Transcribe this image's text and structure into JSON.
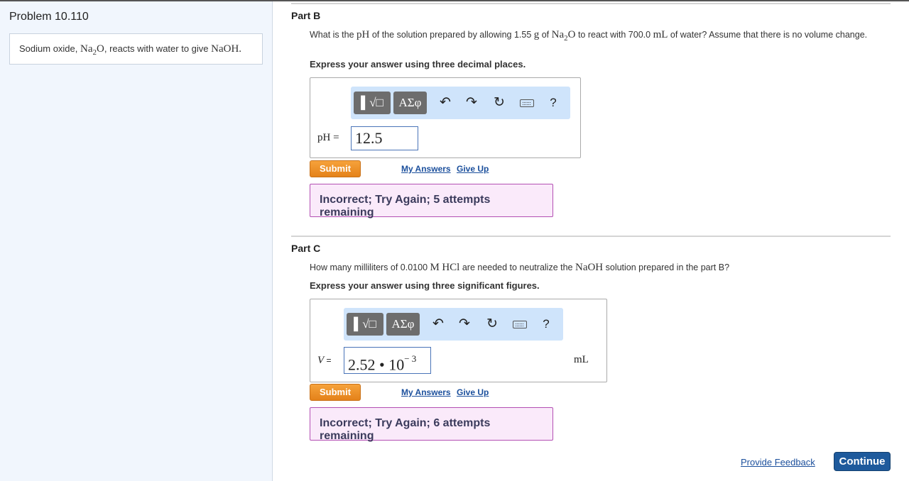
{
  "problem": {
    "title": "Problem 10.110",
    "intro_prefix": "Sodium oxide, ",
    "intro_na2o": "Na",
    "intro_na2o_sub": "2",
    "intro_na2o_o": "O",
    "intro_mid": ", reacts with water to give ",
    "intro_naoh": "NaOH",
    "intro_end": "."
  },
  "part_b": {
    "title": "Part B",
    "q_pre": "What is the ",
    "q_ph": "pH",
    "q_mid1": " of the solution prepared by allowing 1.55 ",
    "q_g": "g",
    "q_mid2": " of ",
    "q_na": "Na",
    "q_sub": "2",
    "q_o": "O",
    "q_mid3": " to react with 700.0 ",
    "q_ml": "mL",
    "q_mid4": " of water? Assume that there is no volume change.",
    "instruction": "Express your answer using three decimal places.",
    "toolbar": {
      "templates": "▌√□",
      "greek": "ΑΣφ",
      "undo": "↶",
      "redo": "↷",
      "reset": "↻",
      "help": "?"
    },
    "var_label": "pH =",
    "input_value": "12.5",
    "submit": "Submit",
    "my_answers": "My Answers",
    "give_up": "Give Up",
    "feedback": "Incorrect; Try Again; 5 attempts remaining"
  },
  "part_c": {
    "title": "Part C",
    "q_pre": "How many milliliters of 0.0100 ",
    "q_m": "M",
    "q_hcl": "HCl",
    "q_mid": " are needed to neutralize the ",
    "q_naoh": "NaOH",
    "q_end": " solution prepared in the part B?",
    "instruction": "Express your answer using three significant figures.",
    "toolbar": {
      "templates": "▌√□",
      "greek": "ΑΣφ",
      "undo": "↶",
      "redo": "↷",
      "reset": "↻",
      "help": "?"
    },
    "var_label": "V",
    "var_eq": " =",
    "input_value": "2.52 • 10",
    "input_exp": "− 3",
    "unit": "mL",
    "submit": "Submit",
    "my_answers": "My Answers",
    "give_up": "Give Up",
    "feedback": "Incorrect; Try Again; 6 attempts remaining"
  },
  "footer": {
    "provide_feedback": "Provide Feedback",
    "continue": "Continue"
  },
  "colors": {
    "submit": "#e98c22",
    "continue": "#1e5a9c",
    "feedback_bg": "#faeafa",
    "feedback_border": "#b34fb3",
    "toolbar_bg": "#cfe4fb",
    "left_pane": "#f1f6fd"
  }
}
